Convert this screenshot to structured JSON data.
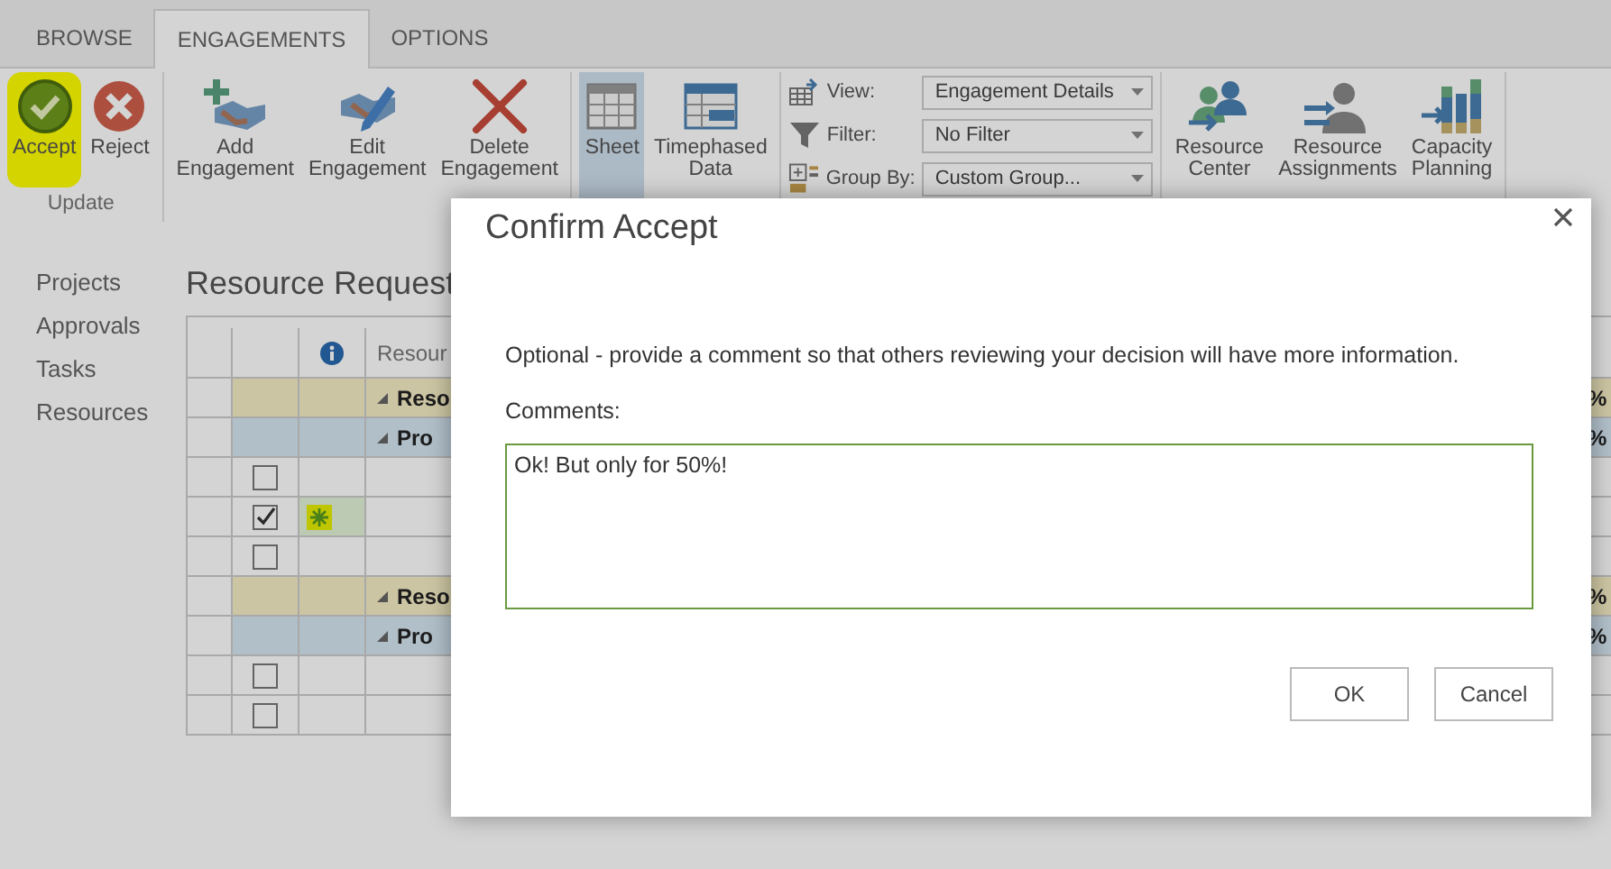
{
  "tabs": [
    {
      "label": "BROWSE",
      "selected": false
    },
    {
      "label": "ENGAGEMENTS",
      "selected": true
    },
    {
      "label": "OPTIONS",
      "selected": false
    }
  ],
  "ribbon": {
    "groups": [
      {
        "kind": "buttons",
        "label": "Update",
        "buttons": [
          {
            "label": "Accept",
            "highlighted": true,
            "selected": false
          },
          {
            "label": "Reject",
            "highlighted": false,
            "selected": false
          }
        ]
      },
      {
        "kind": "buttons",
        "buttons": [
          {
            "label": "Add Engagement",
            "highlighted": false,
            "selected": false
          },
          {
            "label": "Edit Engagement",
            "highlighted": false,
            "selected": false
          },
          {
            "label": "Delete Engagement",
            "highlighted": false,
            "selected": false
          }
        ]
      },
      {
        "kind": "buttons",
        "buttons": [
          {
            "label": "Sheet",
            "highlighted": false,
            "selected": true
          },
          {
            "label": "Timephased Data",
            "highlighted": false,
            "selected": false
          }
        ]
      },
      {
        "kind": "selectors",
        "selectors": [
          {
            "label": "View:",
            "value": "Engagement Details"
          },
          {
            "label": "Filter:",
            "value": "No Filter"
          },
          {
            "label": "Group By:",
            "value": "Custom Group..."
          }
        ]
      },
      {
        "kind": "buttons",
        "buttons": [
          {
            "label": "Resource Center",
            "highlighted": false,
            "selected": false
          },
          {
            "label": "Resource Assignments",
            "highlighted": false,
            "selected": false
          },
          {
            "label": "Capacity Planning",
            "highlighted": false,
            "selected": false
          }
        ]
      }
    ]
  },
  "nav": {
    "items": [
      "Projects",
      "Approvals",
      "Tasks",
      "Resources"
    ]
  },
  "page_title": "Resource Request",
  "table": {
    "columns": [
      {
        "kind": "check"
      },
      {
        "kind": "info"
      },
      {
        "kind": "text",
        "label": "Resour"
      },
      {
        "kind": "value"
      }
    ],
    "rows": [
      {
        "kind": "group",
        "name": "Reso",
        "value": "%"
      },
      {
        "kind": "project",
        "name": "Pro",
        "value": "%"
      },
      {
        "kind": "item",
        "checked": false,
        "flagged": false
      },
      {
        "kind": "item",
        "checked": true,
        "flagged": true
      },
      {
        "kind": "item",
        "checked": false,
        "flagged": false
      },
      {
        "kind": "group",
        "name": "Reso",
        "value": "%"
      },
      {
        "kind": "project",
        "name": "Pro",
        "value": "%"
      },
      {
        "kind": "item",
        "checked": false,
        "flagged": false
      },
      {
        "kind": "item",
        "checked": false,
        "flagged": false
      }
    ]
  },
  "dialog": {
    "title": "Confirm Accept",
    "message": "Optional - provide a comment so that others reviewing your decision will have more information.",
    "comments_label": "Comments:",
    "comments": "Ok! But only for 50%!",
    "buttons": [
      "OK",
      "Cancel"
    ]
  }
}
